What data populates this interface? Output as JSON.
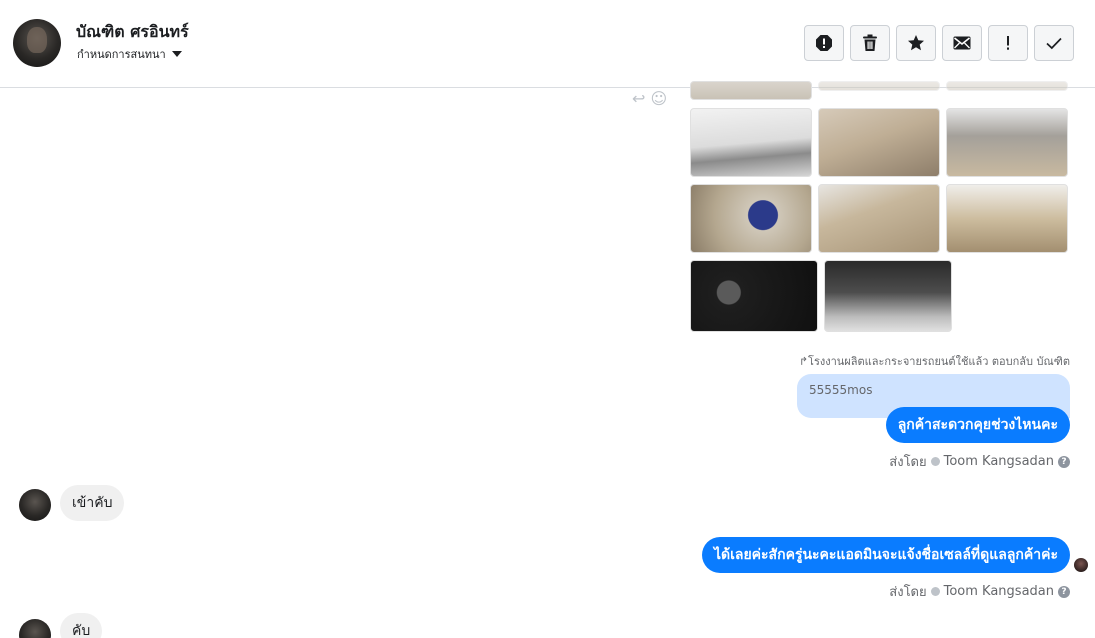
{
  "header": {
    "contact_name": "บัณฑิต ศรอินทร์",
    "assign_label": "กำหนดการสนทนา"
  },
  "toolbar": {
    "buttons": [
      {
        "icon": "spam-alert-icon"
      },
      {
        "icon": "trash-icon"
      },
      {
        "icon": "star-icon"
      },
      {
        "icon": "mail-icon"
      },
      {
        "icon": "exclamation-icon"
      },
      {
        "icon": "check-icon"
      }
    ]
  },
  "thread": {
    "reply_note": "โรงงานผลิตและกระจายรถยนต์ใช้แล้ว ตอบกลับ บัณฑิต",
    "quoted_text": "55555mos",
    "messages": [
      {
        "direction": "out",
        "text": "ลูกค้าสะดวกคุยช่วงไหนคะ"
      },
      {
        "direction": "in",
        "text": "เข้าคับ"
      },
      {
        "direction": "out",
        "text": "ได้เลยค่ะสักครู่นะคะแอดมินจะแจ้งชื่อเซลล์ที่ดูแลลูกค้าค่ะ"
      },
      {
        "direction": "in",
        "text": "คับ"
      }
    ],
    "sent_by_label": "ส่งโดย",
    "sent_by_name": "Toom Kangsadan",
    "help_glyph": "?"
  },
  "colors": {
    "accent_blue": "#0a7cff",
    "quoted_bg": "#cfe3ff",
    "incoming_bg": "#f0f0f0"
  }
}
